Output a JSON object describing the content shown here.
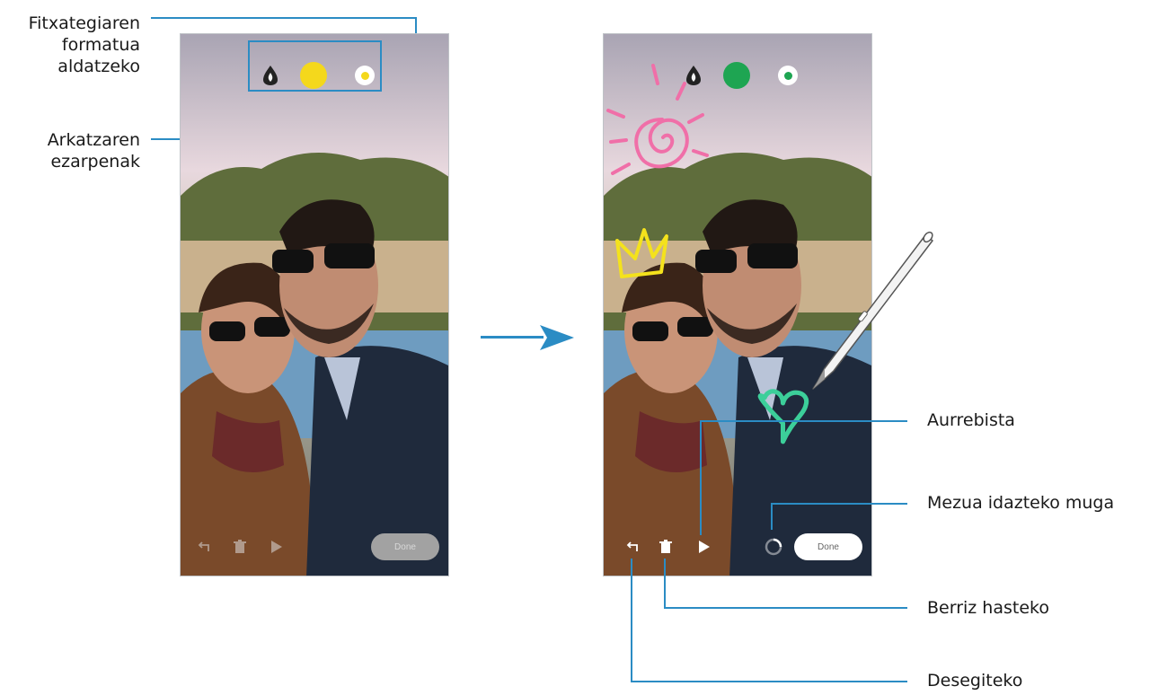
{
  "callouts": {
    "format_lines": [
      "Fitxategiaren",
      "formatua",
      "aldatzeko"
    ],
    "pen_settings_lines": [
      "Arkatzaren",
      "ezarpenak"
    ],
    "preview": "Aurrebista",
    "message_limit": "Mezua idazteko muga",
    "start_over": "Berriz hasteko",
    "undo": "Desegiteko"
  },
  "phone_before": {
    "done_label": "Done",
    "pen_color": "#f4d81c",
    "pen_size_color": "#f4d81c"
  },
  "phone_after": {
    "done_label": "Done",
    "pen_color": "#1ea552",
    "pen_size_color": "#1ea552"
  },
  "icons": {
    "format": "pen-drop-icon",
    "undo": "undo-icon",
    "delete": "trash-icon",
    "play": "play-icon",
    "timer": "timer-ring-icon",
    "flow": "arrow-right-icon",
    "spen": "stylus-pen-icon"
  },
  "colors": {
    "callout_line": "#2b8cc4",
    "arrow": "#2b8cc4",
    "drawing_pink": "#f06fa8",
    "drawing_yellow": "#f4e21c",
    "drawing_green": "#3ccf9a"
  }
}
